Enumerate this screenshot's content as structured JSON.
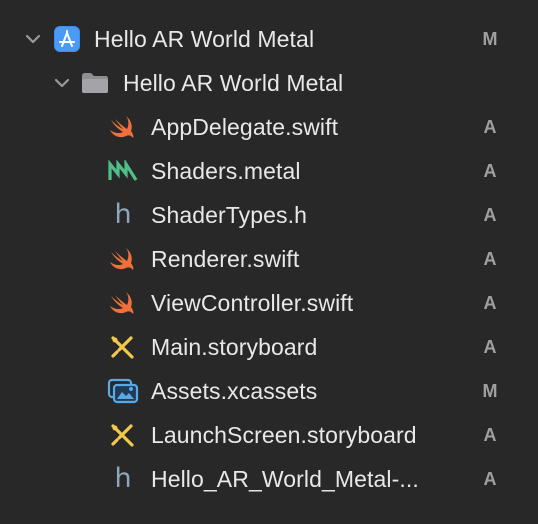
{
  "project": {
    "name": "Hello AR World Metal",
    "status": "M",
    "icon": "xcode-project-icon"
  },
  "group": {
    "name": "Hello AR World Metal",
    "icon": "folder-icon"
  },
  "files": [
    {
      "name": "AppDelegate.swift",
      "status": "A",
      "icon": "swift-icon"
    },
    {
      "name": "Shaders.metal",
      "status": "A",
      "icon": "metal-icon"
    },
    {
      "name": "ShaderTypes.h",
      "status": "A",
      "icon": "header-h-icon"
    },
    {
      "name": "Renderer.swift",
      "status": "A",
      "icon": "swift-icon"
    },
    {
      "name": "ViewController.swift",
      "status": "A",
      "icon": "swift-icon"
    },
    {
      "name": "Main.storyboard",
      "status": "A",
      "icon": "storyboard-icon"
    },
    {
      "name": "Assets.xcassets",
      "status": "M",
      "icon": "asset-catalog-icon"
    },
    {
      "name": "LaunchScreen.storyboard",
      "status": "A",
      "icon": "storyboard-icon"
    },
    {
      "name": "Hello_AR_World_Metal-...",
      "status": "A",
      "icon": "header-h-icon"
    }
  ],
  "colors": {
    "background": "#282828",
    "swift": "#f0703a",
    "metal": "#4fbf8a",
    "project": "#3a8ef0",
    "storyboard": "#f2c94c",
    "status_text": "#a0a0a0"
  }
}
